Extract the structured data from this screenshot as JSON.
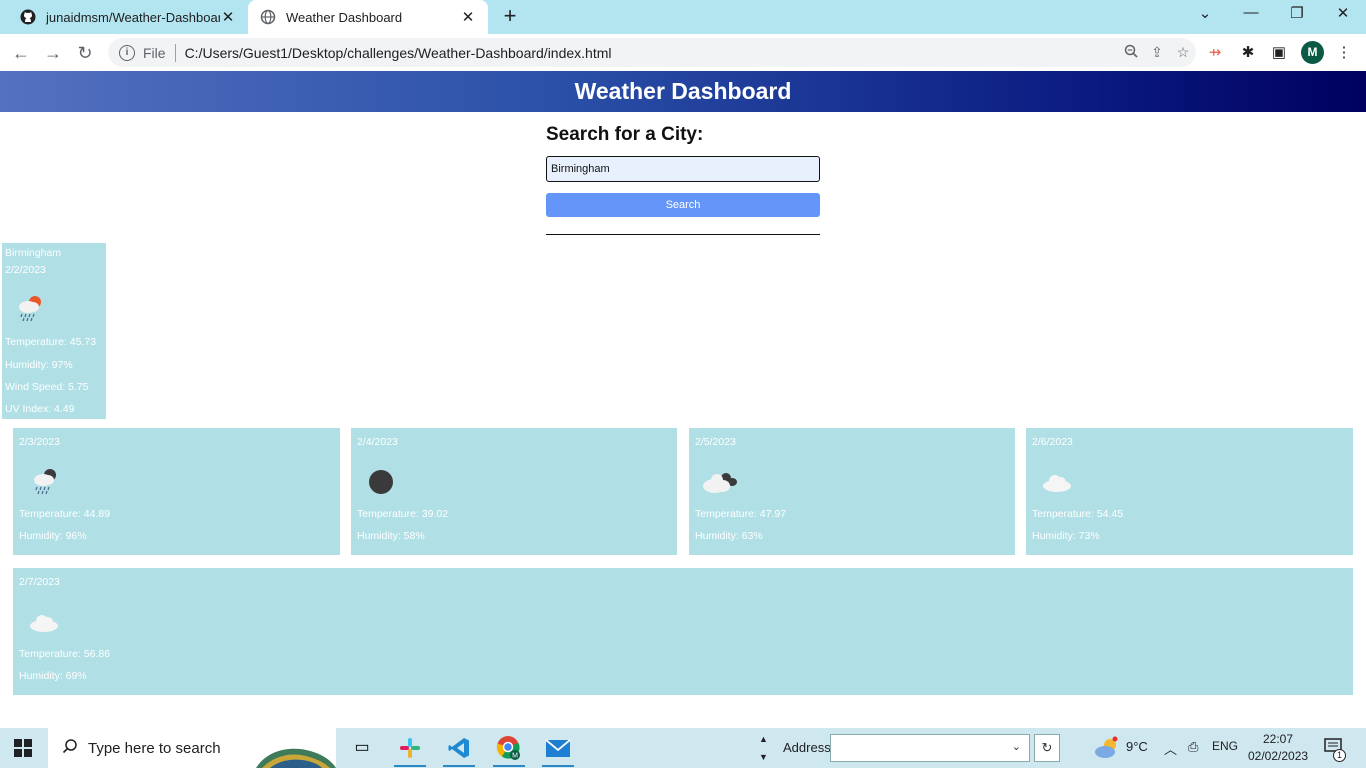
{
  "browser": {
    "tabs": [
      {
        "title": "junaidmsm/Weather-Dashboard",
        "icon": "github-icon",
        "active": false
      },
      {
        "title": "Weather Dashboard",
        "icon": "globe-icon",
        "active": true
      }
    ],
    "address": {
      "scheme": "File",
      "url": "C:/Users/Guest1/Desktop/challenges/Weather-Dashboard/index.html"
    },
    "profile_initial": "M"
  },
  "page": {
    "header_title": "Weather Dashboard",
    "search": {
      "title": "Search for a City:",
      "value": "Birmingham",
      "button_label": "Search"
    },
    "current": {
      "city": "Birmingham",
      "date": "2/2/2023",
      "icon": "rain-sun-cloud-icon",
      "temperature": "Temperature: 45.73",
      "humidity": "Humidity: 97%",
      "wind_speed": "Wind Speed: 5.75",
      "uv_index": "UV Index: 4.49"
    },
    "forecast": [
      {
        "date": "2/3/2023",
        "icon": "rain-night-cloud-icon",
        "temperature": "Temperature: 44.89",
        "humidity": "Humidity: 96%"
      },
      {
        "date": "2/4/2023",
        "icon": "moon-icon",
        "temperature": "Temperature: 39.02",
        "humidity": "Humidity: 58%"
      },
      {
        "date": "2/5/2023",
        "icon": "night-cloud-icon",
        "temperature": "Temperature: 47.97",
        "humidity": "Humidity: 63%"
      },
      {
        "date": "2/6/2023",
        "icon": "cloud-icon",
        "temperature": "Temperature: 54.45",
        "humidity": "Humidity: 73%"
      },
      {
        "date": "2/7/2023",
        "icon": "cloud-icon",
        "temperature": "Temperature: 56.86",
        "humidity": "Humidity: 69%"
      }
    ]
  },
  "taskbar": {
    "search_placeholder": "Type here to search",
    "address_label": "Address",
    "weather_temp": "9°C",
    "language": "ENG",
    "time": "22:07",
    "date": "02/02/2023",
    "notification_count": "1"
  }
}
